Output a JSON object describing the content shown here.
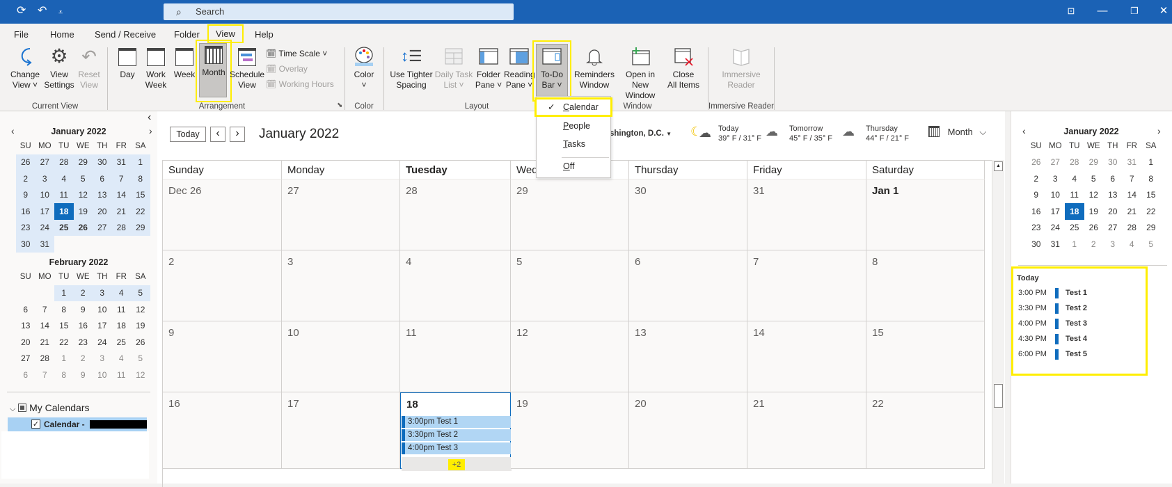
{
  "titlebar": {
    "search_placeholder": "Search",
    "icons": [
      "sync-icon",
      "undo-icon",
      "customize-quick-access-icon"
    ],
    "window_buttons": [
      "coming-soon-icon",
      "minimize-icon",
      "restore-icon",
      "close-icon"
    ]
  },
  "menu_tabs": [
    "File",
    "Home",
    "Send / Receive",
    "Folder",
    "View",
    "Help"
  ],
  "active_tab": "View",
  "ribbon": {
    "current_view": {
      "label": "Current View",
      "buttons": [
        {
          "line1": "Change",
          "line2": "View ˅",
          "icon": "change-view-icon",
          "enabled": true
        },
        {
          "line1": "View",
          "line2": "Settings",
          "icon": "view-settings-icon",
          "enabled": true
        },
        {
          "line1": "Reset",
          "line2": "View",
          "icon": "reset-view-icon",
          "enabled": false
        }
      ]
    },
    "arrangement": {
      "label": "Arrangement",
      "buttons": [
        {
          "line1": "Day",
          "line2": "",
          "icon": "day-view-icon"
        },
        {
          "line1": "Work",
          "line2": "Week",
          "icon": "work-week-icon"
        },
        {
          "line1": "Week",
          "line2": "",
          "icon": "week-view-icon"
        },
        {
          "line1": "Month",
          "line2": "",
          "icon": "month-view-icon",
          "active": true
        },
        {
          "line1": "Schedule",
          "line2": "View",
          "icon": "schedule-view-icon"
        }
      ],
      "small_buttons": [
        {
          "label": "Time Scale ˅",
          "enabled": true
        },
        {
          "label": "Overlay",
          "enabled": false
        },
        {
          "label": "Working Hours",
          "enabled": false
        }
      ]
    },
    "color": {
      "label": "Color",
      "button": {
        "line1": "Color",
        "line2": "˅"
      }
    },
    "layout": {
      "label": "Layout",
      "buttons": [
        {
          "line1": "Use Tighter",
          "line2": "Spacing",
          "enabled": true
        },
        {
          "line1": "Daily Task",
          "line2": "List ˅",
          "enabled": false
        },
        {
          "line1": "Folder",
          "line2": "Pane ˅",
          "enabled": true
        },
        {
          "line1": "Reading",
          "line2": "Pane ˅",
          "enabled": true
        },
        {
          "line1": "To-Do",
          "line2": "Bar ˅",
          "enabled": true,
          "active": true
        }
      ]
    },
    "window": {
      "label": "Window",
      "buttons": [
        {
          "line1": "Reminders",
          "line2": "Window"
        },
        {
          "line1": "Open in New",
          "line2": "Window"
        },
        {
          "line1": "Close",
          "line2": "All Items"
        }
      ]
    },
    "immersive_reader": {
      "label": "Immersive Reader",
      "button": {
        "line1": "Immersive",
        "line2": "Reader",
        "enabled": false
      }
    }
  },
  "todo_bar_menu": {
    "items": [
      {
        "label": "Calendar",
        "underline": "C",
        "rest": "alendar",
        "checked": true
      },
      {
        "label": "People",
        "underline": "P",
        "rest": "eople",
        "checked": false
      },
      {
        "label": "Tasks",
        "underline": "T",
        "rest": "asks",
        "checked": false
      },
      {
        "label": "Off",
        "underline": "O",
        "rest": "ff",
        "checked": false
      }
    ],
    "check_glyph": "✓"
  },
  "left_pane": {
    "collapse_glyph": "‹",
    "weekday_headers": [
      "SU",
      "MO",
      "TU",
      "WE",
      "TH",
      "FR",
      "SA"
    ],
    "month1": {
      "title": "January 2022",
      "weeks": [
        [
          "26",
          "27",
          "28",
          "29",
          "30",
          "31",
          "1"
        ],
        [
          "2",
          "3",
          "4",
          "5",
          "6",
          "7",
          "8"
        ],
        [
          "9",
          "10",
          "11",
          "12",
          "13",
          "14",
          "15"
        ],
        [
          "16",
          "17",
          "18",
          "19",
          "20",
          "21",
          "22"
        ],
        [
          "23",
          "24",
          "25",
          "26",
          "27",
          "28",
          "29"
        ],
        [
          "30",
          "31",
          "",
          "",
          "",
          "",
          ""
        ]
      ],
      "today": "18",
      "bold_days": [
        "25",
        "26"
      ]
    },
    "month2": {
      "title": "February 2022",
      "weeks": [
        [
          "",
          "",
          "1",
          "2",
          "3",
          "4",
          "5"
        ],
        [
          "6",
          "7",
          "8",
          "9",
          "10",
          "11",
          "12"
        ],
        [
          "13",
          "14",
          "15",
          "16",
          "17",
          "18",
          "19"
        ],
        [
          "20",
          "21",
          "22",
          "23",
          "24",
          "25",
          "26"
        ],
        [
          "27",
          "28",
          "1",
          "2",
          "3",
          "4",
          "5"
        ],
        [
          "6",
          "7",
          "8",
          "9",
          "10",
          "11",
          "12"
        ]
      ]
    },
    "folders": {
      "group_label": "My Calendars",
      "calendar_label": "Calendar -",
      "calendar_checked": true
    }
  },
  "main": {
    "today_button": "Today",
    "prev_glyph": "‹",
    "next_glyph": "›",
    "title": "January 2022",
    "location": "shington, D.C.",
    "weather": [
      {
        "day": "Today",
        "temps": "39° F / 31° F",
        "icon": "partly-cloudy-night-icon"
      },
      {
        "day": "Tomorrow",
        "temps": "45° F / 35° F",
        "icon": "cloudy-icon"
      },
      {
        "day": "Thursday",
        "temps": "44° F / 21° F",
        "icon": "cloudy-icon"
      }
    ],
    "view_selector": "Month",
    "day_headers": [
      "Sunday",
      "Monday",
      "Tuesday",
      "Wednesday",
      "Thursday",
      "Friday",
      "Saturday"
    ],
    "current_weekday": "Tuesday",
    "weeks": [
      [
        "Dec 26",
        "27",
        "28",
        "29",
        "30",
        "31",
        "Jan 1"
      ],
      [
        "2",
        "3",
        "4",
        "5",
        "6",
        "7",
        "8"
      ],
      [
        "9",
        "10",
        "11",
        "12",
        "13",
        "14",
        "15"
      ],
      [
        "16",
        "17",
        "18",
        "19",
        "20",
        "21",
        "22"
      ]
    ],
    "today_cell": "18",
    "bold_cells": [
      "Jan 1"
    ],
    "today_events": [
      {
        "time": "3:00pm",
        "title": "Test 1"
      },
      {
        "time": "3:30pm",
        "title": "Test 2"
      },
      {
        "time": "4:00pm",
        "title": "Test 3"
      }
    ],
    "more_label": "+2"
  },
  "right_pane": {
    "month": {
      "title": "January 2022",
      "weeks": [
        [
          "26",
          "27",
          "28",
          "29",
          "30",
          "31",
          "1"
        ],
        [
          "2",
          "3",
          "4",
          "5",
          "6",
          "7",
          "8"
        ],
        [
          "9",
          "10",
          "11",
          "12",
          "13",
          "14",
          "15"
        ],
        [
          "16",
          "17",
          "18",
          "19",
          "20",
          "21",
          "22"
        ],
        [
          "23",
          "24",
          "25",
          "26",
          "27",
          "28",
          "29"
        ],
        [
          "30",
          "31",
          "1",
          "2",
          "3",
          "4",
          "5"
        ]
      ],
      "today": "18"
    },
    "agenda_title": "Today",
    "agenda": [
      {
        "time": "3:00 PM",
        "title": "Test 1"
      },
      {
        "time": "3:30 PM",
        "title": "Test 2"
      },
      {
        "time": "4:00 PM",
        "title": "Test 3"
      },
      {
        "time": "4:30 PM",
        "title": "Test 4"
      },
      {
        "time": "6:00 PM",
        "title": "Test 5"
      }
    ]
  },
  "colors": {
    "titlebar": "#1b62b5",
    "accent": "#0f6cbd",
    "event_bg": "#b1d6f4",
    "highlight": "#ffee00"
  }
}
